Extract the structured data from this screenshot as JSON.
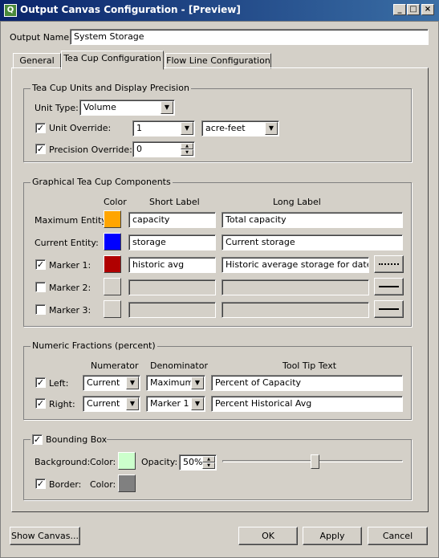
{
  "window": {
    "title": "Output Canvas Configuration - [Preview]",
    "app_icon": "app-icon",
    "controls": [
      "minimize-icon",
      "maximize-icon",
      "close-icon"
    ]
  },
  "output_name": {
    "label": "Output Name:",
    "value": "System Storage"
  },
  "tabs": [
    {
      "label": "General",
      "active": false
    },
    {
      "label": "Tea Cup Configuration",
      "active": true
    },
    {
      "label": "Flow Line Configuration",
      "active": false
    }
  ],
  "units_group": {
    "title": "Tea Cup Units and Display Precision",
    "unit_type_label": "Unit Type:",
    "unit_type_value": "Volume",
    "unit_override_label": "Unit Override:",
    "unit_override_checked": true,
    "unit_override_value": "1",
    "unit_override_unit": "acre-feet",
    "precision_override_label": "Precision Override:",
    "precision_override_checked": true,
    "precision_value": "0"
  },
  "components_group": {
    "title": "Graphical Tea Cup Components",
    "headers": {
      "color": "Color",
      "short": "Short Label",
      "long": "Long Label"
    },
    "rows": [
      {
        "label": "Maximum Entity:",
        "has_checkbox": false,
        "checked": false,
        "color": "#ffa500",
        "short": "capacity",
        "long": "Total capacity",
        "line": ""
      },
      {
        "label": "Current Entity:",
        "has_checkbox": false,
        "checked": false,
        "color": "#0000ff",
        "short": "storage",
        "long": "Current storage",
        "line": ""
      },
      {
        "label": "Marker 1:",
        "has_checkbox": true,
        "checked": true,
        "color": "#b00000",
        "short": "historic avg",
        "long": "Historic average storage for date",
        "line": "dotted"
      },
      {
        "label": "Marker 2:",
        "has_checkbox": true,
        "checked": false,
        "color": "",
        "short": "",
        "long": "",
        "line": "solid"
      },
      {
        "label": "Marker 3:",
        "has_checkbox": true,
        "checked": false,
        "color": "",
        "short": "",
        "long": "",
        "line": "solid"
      }
    ]
  },
  "fractions_group": {
    "title": "Numeric Fractions (percent)",
    "headers": {
      "numerator": "Numerator",
      "denominator": "Denominator",
      "tooltip": "Tool Tip Text"
    },
    "rows": [
      {
        "label": "Left:",
        "checked": true,
        "numerator": "Current",
        "denominator": "Maximum",
        "tooltip": "Percent of Capacity"
      },
      {
        "label": "Right:",
        "checked": true,
        "numerator": "Current",
        "denominator": "Marker 1",
        "tooltip": "Percent Historical Avg"
      }
    ]
  },
  "bounding_box": {
    "title": "Bounding Box",
    "checked": true,
    "background_label": "Background:",
    "color_label": "Color:",
    "background_color": "#ccffcc",
    "opacity_label": "Opacity:",
    "opacity_value": "50%",
    "opacity_fraction": 0.5,
    "border_label": "Border:",
    "border_checked": true,
    "border_color_label": "Color:",
    "border_color": "#808080"
  },
  "footer": {
    "show_canvas": "Show Canvas...",
    "ok": "OK",
    "apply": "Apply",
    "cancel": "Cancel"
  }
}
